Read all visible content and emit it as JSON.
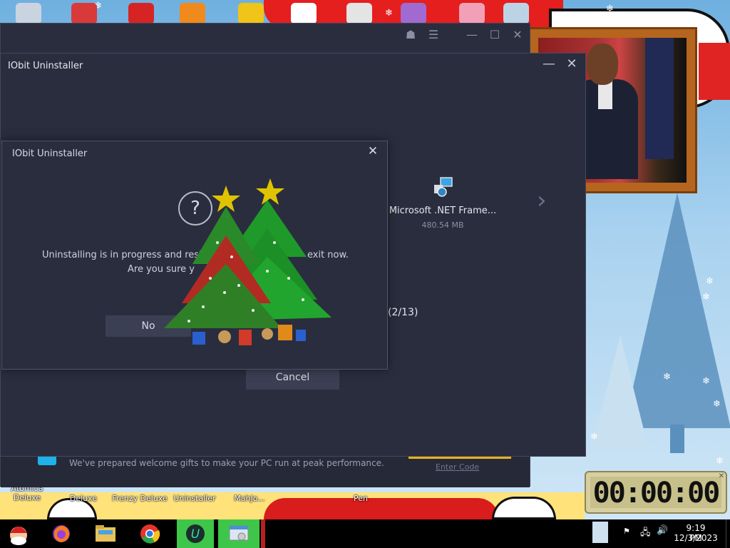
{
  "desktop": {
    "icons_top": [
      {
        "name": "recycle-bin-icon",
        "color": "#c9d4e0"
      },
      {
        "name": "globe-app-icon",
        "color": "#d83a3a"
      },
      {
        "name": "red-ball-icon",
        "color": "#d62424"
      },
      {
        "name": "firefox-like-icon",
        "color": "#f08a1c"
      },
      {
        "name": "game-box-icon",
        "color": "#f0c419"
      },
      {
        "name": "bird-icon",
        "color": "#ffffff"
      },
      {
        "name": "flowers-icon",
        "color": "#e4e4e4"
      },
      {
        "name": "envelope-icon",
        "color": "#a06ad0"
      },
      {
        "name": "pink-flower-icon",
        "color": "#f2a0b8"
      },
      {
        "name": "monitor-icon",
        "color": "#bcd3e6"
      }
    ],
    "icon_labels_bottom": [
      "Atomica Deluxe",
      "Deluxe",
      "Frenzy Deluxe",
      "Uninstaller",
      "MahJo...",
      "Pen"
    ],
    "timer_display": "00:00:00"
  },
  "back_window": {
    "promo_text": "We've prepared welcome gifts to make your PC run at peak performance.",
    "promo_link": "Enter Code"
  },
  "front_window": {
    "title": "IObit Uninstaller",
    "program_name": "Microsoft .NET Frame...",
    "program_size": "480.54 MB",
    "status": "e (2/13)",
    "cancel_label": "Cancel"
  },
  "dialog": {
    "title": "IObit Uninstaller",
    "question_mark": "?",
    "message_line1": "Uninstalling is in progress and resid",
    "message_line1_end": "exit now.",
    "message_line2": "Are you sure y",
    "no_label": "No"
  },
  "taskbar": {
    "time": "9:19 PM",
    "date": "12/3/2023",
    "accent": "#3ec64b"
  }
}
